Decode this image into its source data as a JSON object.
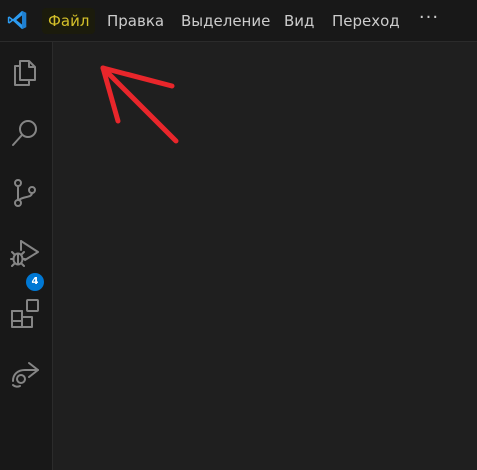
{
  "window": {
    "app_logo_icon": "vscode-logo-icon",
    "accent_color": "#0078d4"
  },
  "menubar": {
    "items": [
      {
        "label": "Файл",
        "highlighted": true
      },
      {
        "label": "Правка"
      },
      {
        "label": "Выделение"
      },
      {
        "label": "Вид"
      },
      {
        "label": "Переход"
      }
    ],
    "more_label": "···"
  },
  "activitybar": {
    "items": [
      {
        "icon": "explorer-files-icon"
      },
      {
        "icon": "search-icon"
      },
      {
        "icon": "source-control-icon"
      },
      {
        "icon": "run-and-debug-icon"
      },
      {
        "icon": "extensions-icon",
        "badge": "4"
      },
      {
        "icon": "remote-share-icon"
      }
    ]
  },
  "annotation": {
    "type": "red-arrow",
    "color": "#e8262b",
    "points_to": "Файл"
  }
}
